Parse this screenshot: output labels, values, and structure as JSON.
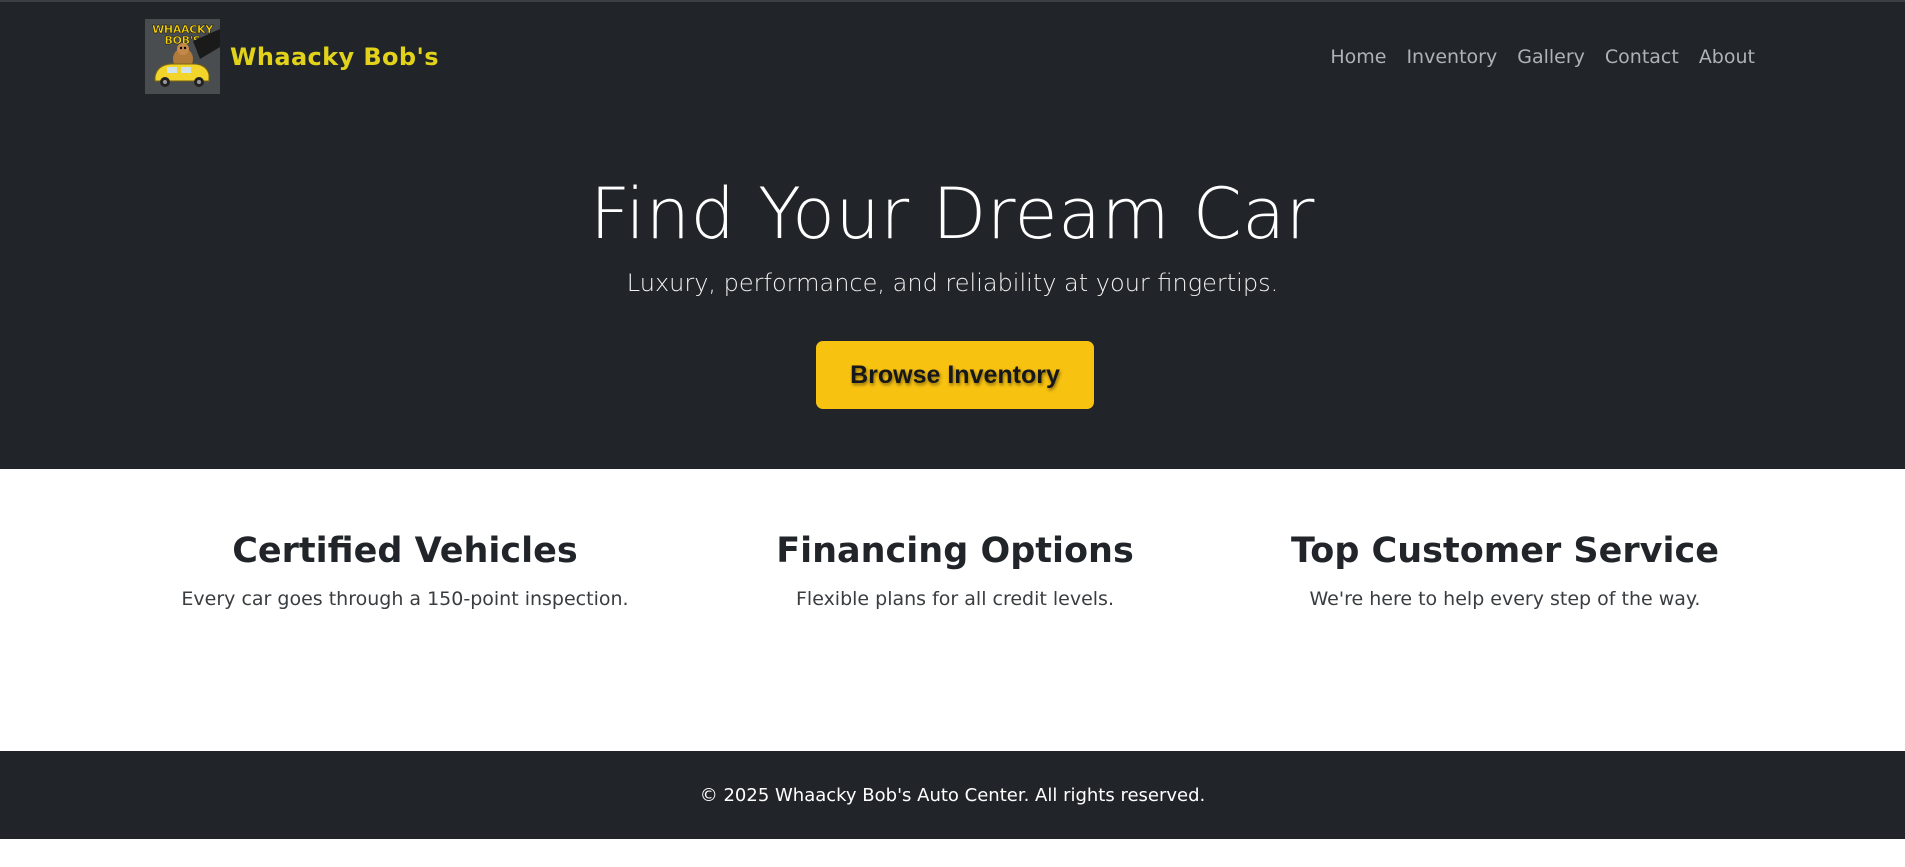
{
  "nav": {
    "brand_name": "Whaacky Bob's",
    "logo_text": "WHAACKY BOB'S",
    "links": [
      "Home",
      "Inventory",
      "Gallery",
      "Contact",
      "About"
    ]
  },
  "hero": {
    "title": "Find Your Dream Car",
    "subtitle": "Luxury, performance, and reliability at your fingertips.",
    "cta_label": "Browse Inventory"
  },
  "features": [
    {
      "title": "Certified Vehicles",
      "description": "Every car goes through a 150-point inspection."
    },
    {
      "title": "Financing Options",
      "description": "Flexible plans for all credit levels."
    },
    {
      "title": "Top Customer Service",
      "description": "We're here to help every step of the way."
    }
  ],
  "footer": {
    "text": "© 2025 Whaacky Bob's Auto Center. All rights reserved."
  },
  "colors": {
    "dark_bg": "#212529",
    "brand_yellow": "#e2d31a",
    "button_yellow": "#f8c211"
  },
  "icons": {
    "logo": "cartoon-car-logo"
  }
}
